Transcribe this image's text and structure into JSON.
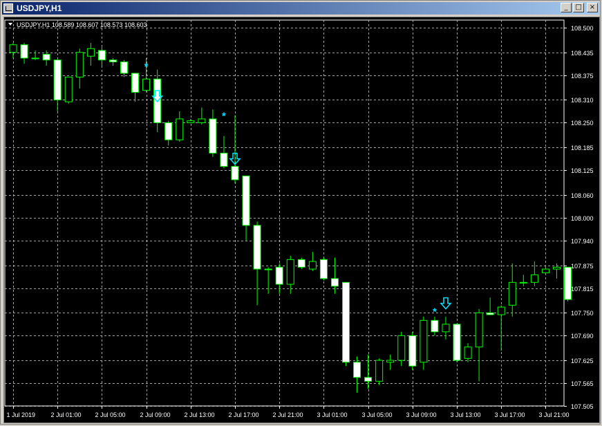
{
  "window": {
    "title": "USDJPY,H1",
    "buttons": {
      "minimize": "_",
      "maximize": "□",
      "close": "×"
    }
  },
  "colors": {
    "background": "#000000",
    "foreground": "#ffffff",
    "candle_outline": "#00ff00",
    "bull_fill": "#000000",
    "bear_fill": "#ffffff",
    "grid": "#c0c0c0",
    "marker": "#00e5ff"
  },
  "chart_data": {
    "type": "candlestick",
    "symbol": "USDJPY",
    "timeframe": "H1",
    "info_label": "USDJPY,H1  108.589 108.607 108.573 108.603",
    "ohlc_label": {
      "symbol": "USDJPY,H1",
      "open": 108.589,
      "high": 108.607,
      "low": 108.573,
      "close": 108.603
    },
    "ylim": [
      107.505,
      108.52
    ],
    "yticks": [
      "108.500",
      "108.435",
      "108.375",
      "108.310",
      "108.250",
      "108.185",
      "108.125",
      "108.060",
      "108.000",
      "107.940",
      "107.875",
      "107.815",
      "107.750",
      "107.690",
      "107.625",
      "107.565",
      "107.505"
    ],
    "xticks": [
      {
        "label": "1 Jul 2019",
        "index": 0
      },
      {
        "label": "2 Jul 01:00",
        "index": 4
      },
      {
        "label": "2 Jul 05:00",
        "index": 8
      },
      {
        "label": "2 Jul 09:00",
        "index": 12
      },
      {
        "label": "2 Jul 13:00",
        "index": 16
      },
      {
        "label": "2 Jul 17:00",
        "index": 20
      },
      {
        "label": "2 Jul 21:00",
        "index": 24
      },
      {
        "label": "3 Jul 01:00",
        "index": 28
      },
      {
        "label": "3 Jul 05:00",
        "index": 32
      },
      {
        "label": "3 Jul 09:00",
        "index": 36
      },
      {
        "label": "3 Jul 13:00",
        "index": 40
      },
      {
        "label": "3 Jul 17:00",
        "index": 44
      },
      {
        "label": "3 Jul 21:00",
        "index": 48
      }
    ],
    "candles": [
      {
        "o": 108.435,
        "h": 108.46,
        "l": 108.42,
        "c": 108.455
      },
      {
        "o": 108.455,
        "h": 108.46,
        "l": 108.405,
        "c": 108.42
      },
      {
        "o": 108.42,
        "h": 108.44,
        "l": 108.415,
        "c": 108.42
      },
      {
        "o": 108.43,
        "h": 108.44,
        "l": 108.4,
        "c": 108.415
      },
      {
        "o": 108.415,
        "h": 108.415,
        "l": 108.28,
        "c": 108.31
      },
      {
        "o": 108.305,
        "h": 108.36,
        "l": 108.3,
        "c": 108.37
      },
      {
        "o": 108.37,
        "h": 108.445,
        "l": 108.34,
        "c": 108.435
      },
      {
        "o": 108.425,
        "h": 108.46,
        "l": 108.4,
        "c": 108.445
      },
      {
        "o": 108.44,
        "h": 108.45,
        "l": 108.395,
        "c": 108.415
      },
      {
        "o": 108.415,
        "h": 108.42,
        "l": 108.4,
        "c": 108.41
      },
      {
        "o": 108.41,
        "h": 108.415,
        "l": 108.37,
        "c": 108.38
      },
      {
        "o": 108.38,
        "h": 108.375,
        "l": 108.305,
        "c": 108.33
      },
      {
        "o": 108.335,
        "h": 108.42,
        "l": 108.33,
        "c": 108.365
      },
      {
        "o": 108.365,
        "h": 108.39,
        "l": 108.225,
        "c": 108.25
      },
      {
        "o": 108.25,
        "h": 108.255,
        "l": 108.19,
        "c": 108.205
      },
      {
        "o": 108.205,
        "h": 108.28,
        "l": 108.2,
        "c": 108.26
      },
      {
        "o": 108.25,
        "h": 108.26,
        "l": 108.25,
        "c": 108.255
      },
      {
        "o": 108.25,
        "h": 108.29,
        "l": 108.245,
        "c": 108.26
      },
      {
        "o": 108.26,
        "h": 108.285,
        "l": 108.16,
        "c": 108.17
      },
      {
        "o": 108.17,
        "h": 108.215,
        "l": 108.13,
        "c": 108.135
      },
      {
        "o": 108.135,
        "h": 108.27,
        "l": 108.09,
        "c": 108.1
      },
      {
        "o": 108.11,
        "h": 108.1,
        "l": 107.94,
        "c": 107.98
      },
      {
        "o": 107.98,
        "h": 107.99,
        "l": 107.77,
        "c": 107.865
      },
      {
        "o": 107.865,
        "h": 107.87,
        "l": 107.8,
        "c": 107.865
      },
      {
        "o": 107.87,
        "h": 107.88,
        "l": 107.8,
        "c": 107.825
      },
      {
        "o": 107.825,
        "h": 107.9,
        "l": 107.8,
        "c": 107.89
      },
      {
        "o": 107.89,
        "h": 107.895,
        "l": 107.865,
        "c": 107.87
      },
      {
        "o": 107.865,
        "h": 107.91,
        "l": 107.86,
        "c": 107.885
      },
      {
        "o": 107.89,
        "h": 107.895,
        "l": 107.835,
        "c": 107.84
      },
      {
        "o": 107.84,
        "h": 107.895,
        "l": 107.8,
        "c": 107.82
      },
      {
        "o": 107.83,
        "h": 107.83,
        "l": 107.61,
        "c": 107.62
      },
      {
        "o": 107.62,
        "h": 107.635,
        "l": 107.54,
        "c": 107.58
      },
      {
        "o": 107.58,
        "h": 107.64,
        "l": 107.55,
        "c": 107.57
      },
      {
        "o": 107.57,
        "h": 107.63,
        "l": 107.56,
        "c": 107.625
      },
      {
        "o": 107.62,
        "h": 107.64,
        "l": 107.6,
        "c": 107.625
      },
      {
        "o": 107.625,
        "h": 107.7,
        "l": 107.61,
        "c": 107.69
      },
      {
        "o": 107.69,
        "h": 107.7,
        "l": 107.6,
        "c": 107.61
      },
      {
        "o": 107.62,
        "h": 107.74,
        "l": 107.6,
        "c": 107.73
      },
      {
        "o": 107.73,
        "h": 107.74,
        "l": 107.69,
        "c": 107.7
      },
      {
        "o": 107.7,
        "h": 107.74,
        "l": 107.68,
        "c": 107.72
      },
      {
        "o": 107.72,
        "h": 107.72,
        "l": 107.62,
        "c": 107.625
      },
      {
        "o": 107.63,
        "h": 107.67,
        "l": 107.62,
        "c": 107.66
      },
      {
        "o": 107.66,
        "h": 107.76,
        "l": 107.57,
        "c": 107.75
      },
      {
        "o": 107.75,
        "h": 107.79,
        "l": 107.745,
        "c": 107.745
      },
      {
        "o": 107.745,
        "h": 107.77,
        "l": 107.65,
        "c": 107.765
      },
      {
        "o": 107.77,
        "h": 107.88,
        "l": 107.74,
        "c": 107.83
      },
      {
        "o": 107.83,
        "h": 107.85,
        "l": 107.82,
        "c": 107.83
      },
      {
        "o": 107.83,
        "h": 107.885,
        "l": 107.82,
        "c": 107.85
      },
      {
        "o": 107.855,
        "h": 107.875,
        "l": 107.85,
        "c": 107.865
      },
      {
        "o": 107.865,
        "h": 107.88,
        "l": 107.84,
        "c": 107.87
      },
      {
        "o": 107.87,
        "h": 107.87,
        "l": 107.78,
        "c": 107.785
      }
    ],
    "markers": [
      {
        "type": "star",
        "index": 12,
        "price": 108.4
      },
      {
        "type": "arrow-down",
        "index": 13,
        "price": 108.32
      },
      {
        "type": "star",
        "index": 19,
        "price": 108.27
      },
      {
        "type": "arrow-down",
        "index": 20,
        "price": 108.155
      },
      {
        "type": "star",
        "index": 38,
        "price": 107.755
      },
      {
        "type": "arrow-down",
        "index": 39,
        "price": 107.775
      }
    ]
  }
}
